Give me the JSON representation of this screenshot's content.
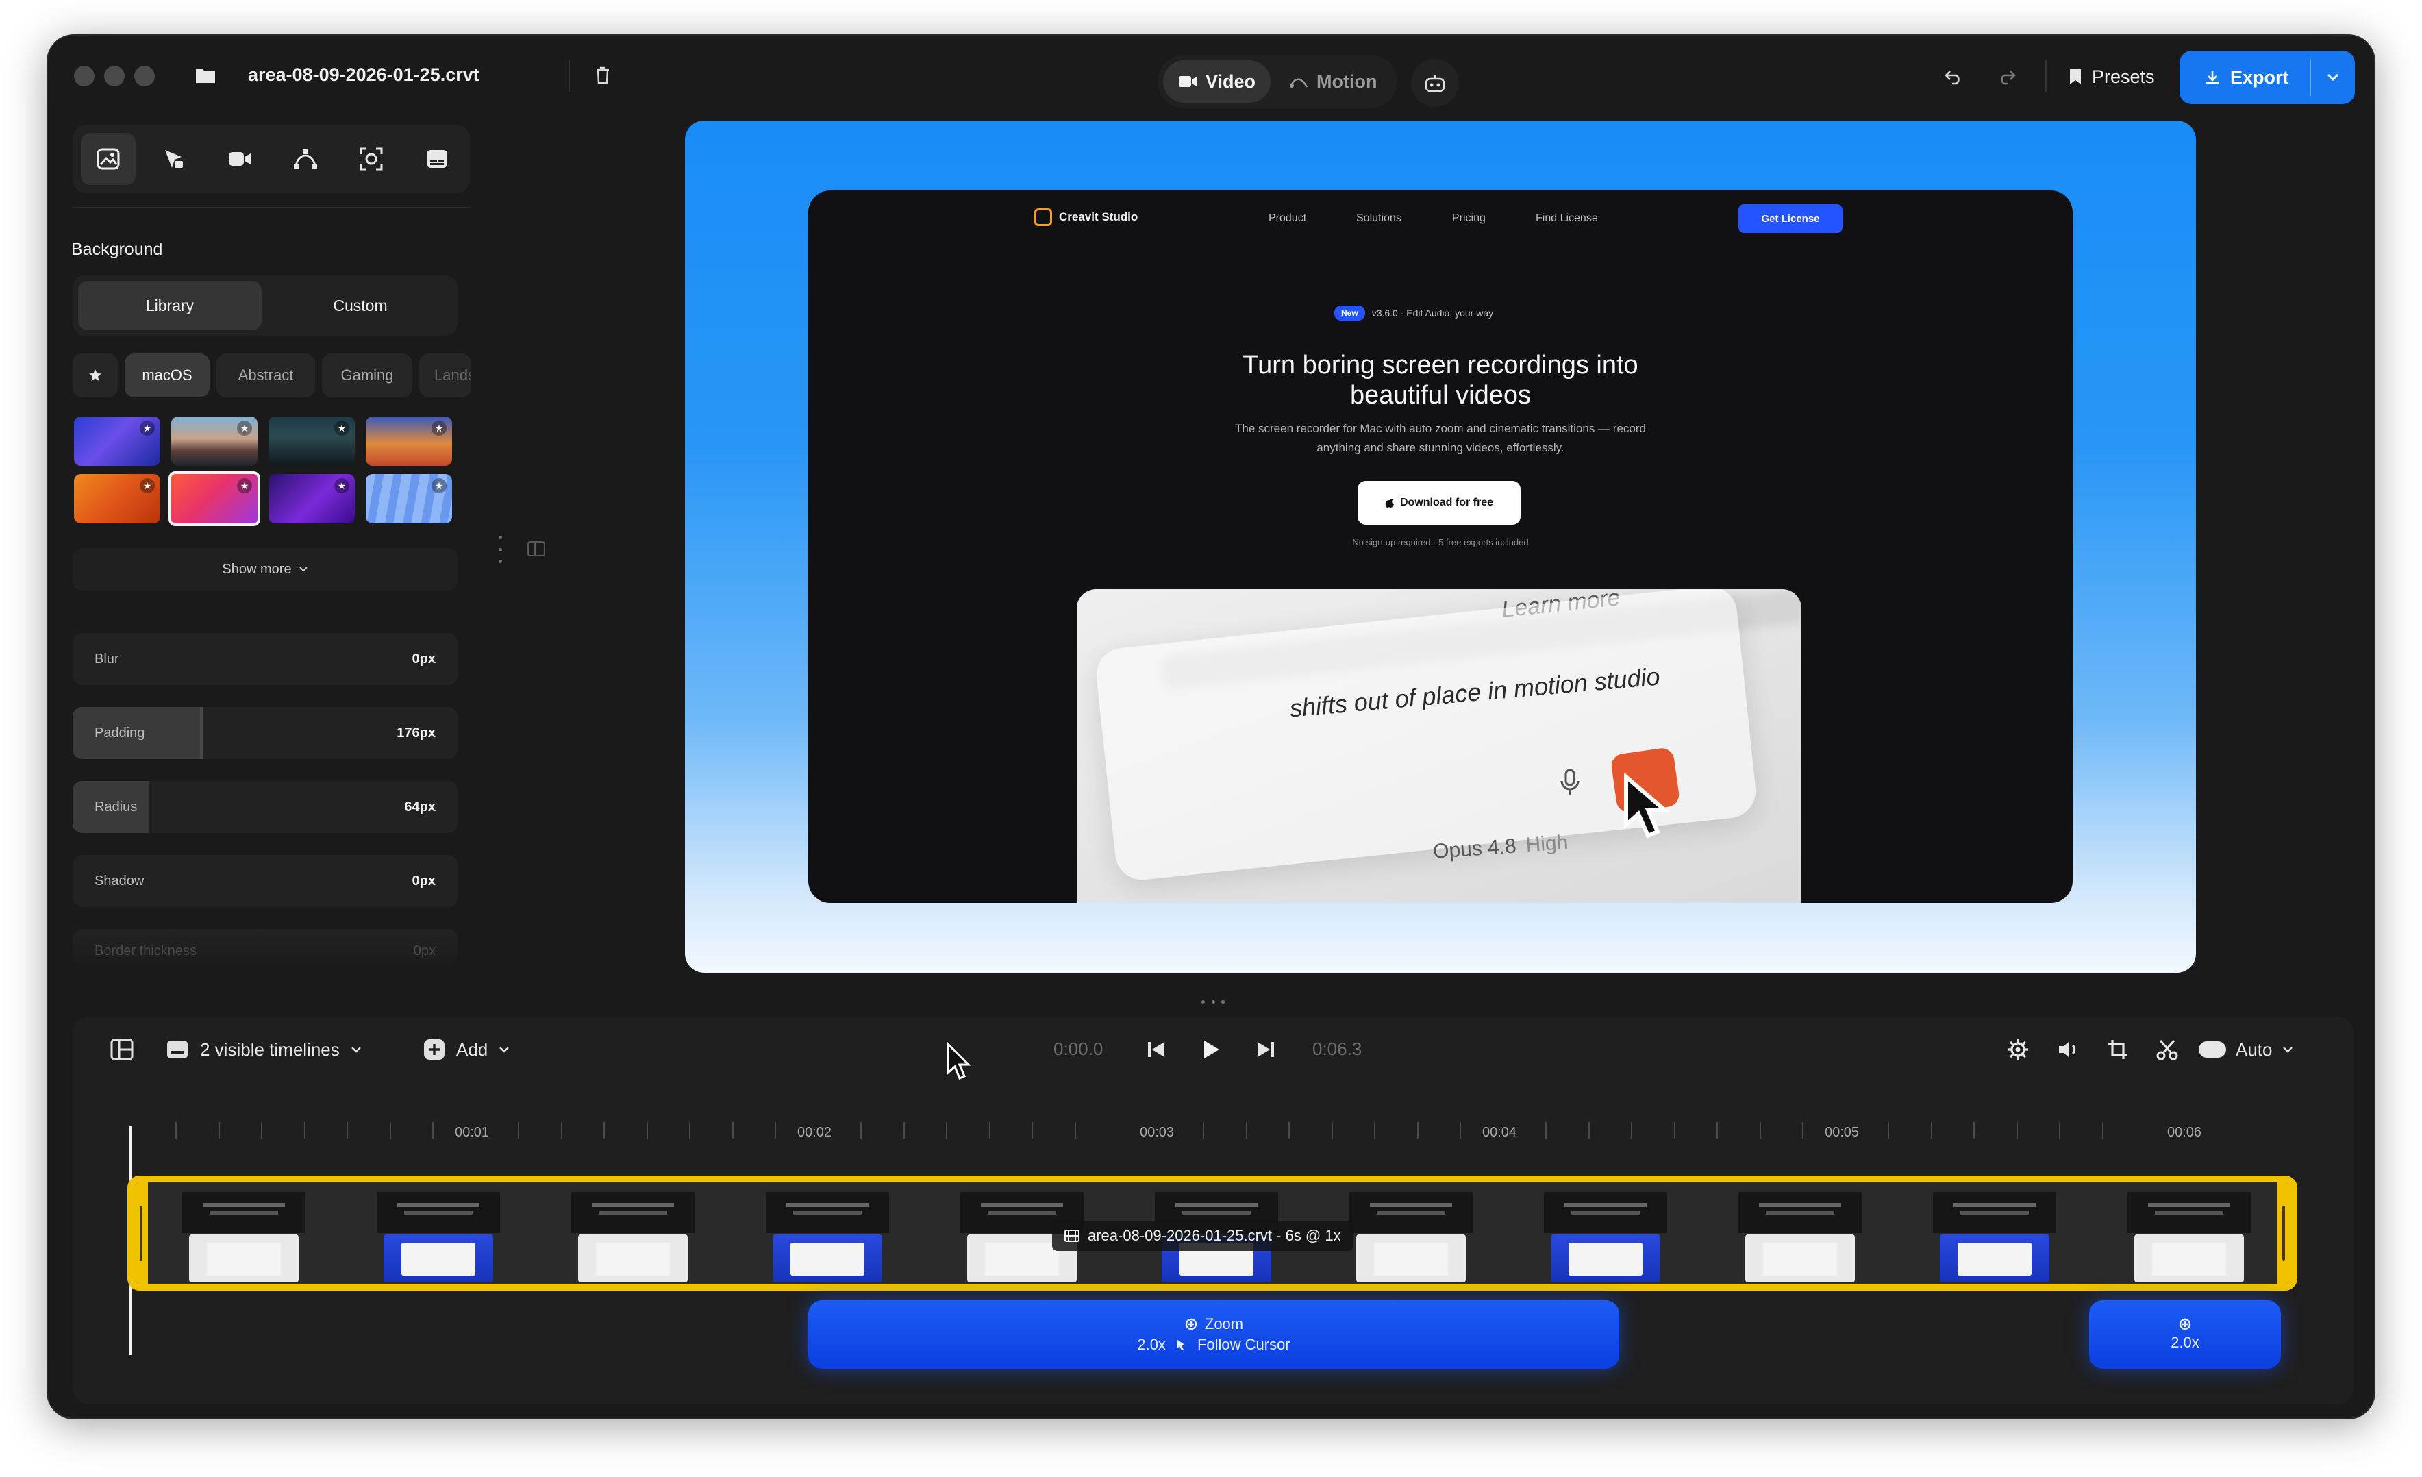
{
  "toolbar": {
    "filename": "area-08-09-2026-01-25.crvt",
    "mode_video": "Video",
    "mode_motion": "Motion",
    "presets": "Presets",
    "export": "Export"
  },
  "sidebar": {
    "background_title": "Background",
    "library": "Library",
    "custom": "Custom",
    "categories": [
      "macOS",
      "Abstract",
      "Gaming",
      "Landscape"
    ],
    "show_more": "Show more",
    "sliders": [
      {
        "label": "Blur",
        "value": "0px",
        "fill": 0
      },
      {
        "label": "Padding",
        "value": "176px",
        "fill": 0.34
      },
      {
        "label": "Radius",
        "value": "64px",
        "fill": 0.2
      },
      {
        "label": "Shadow",
        "value": "0px",
        "fill": 0
      },
      {
        "label": "Border thickness",
        "value": "0px",
        "fill": 0
      }
    ]
  },
  "preview": {
    "brand": "Creavit Studio",
    "nav": [
      "Product",
      "Solutions",
      "Pricing",
      "Find License"
    ],
    "cta": "Get License",
    "badge_new": "New",
    "badge_text": "v3.6.0 · Edit Audio, your way",
    "headline_1": "Turn boring screen recordings into",
    "headline_2": "beautiful videos",
    "sub_1": "The screen recorder for Mac with auto zoom and cinematic transitions — record",
    "sub_2": "anything and share stunning videos, effortlessly.",
    "download": "Download for free",
    "fineprint": "No sign-up required · 5 free exports included",
    "demo_learn": "Learn more",
    "demo_text": "shifts out of place in motion studio",
    "demo_model": "Opus 4.8",
    "demo_effort": "High"
  },
  "timeline": {
    "visible_timelines": "2 visible timelines",
    "add": "Add",
    "current_time": "0:00.0",
    "duration": "0:06.3",
    "auto": "Auto",
    "ruler": [
      "00:01",
      "00:02",
      "00:03",
      "00:04",
      "00:05",
      "00:06"
    ],
    "clip_label": "area-08-09-2026-01-25.crvt - 6s @ 1x",
    "zoom1_title": "Zoom",
    "zoom1_detail": "2.0x",
    "zoom1_mode": "Follow Cursor",
    "zoom2_detail": "2.0x"
  },
  "colors": {
    "accent": "#1677f0",
    "clip_border": "#f0c300",
    "zoom_block": "#1e5cf5"
  }
}
